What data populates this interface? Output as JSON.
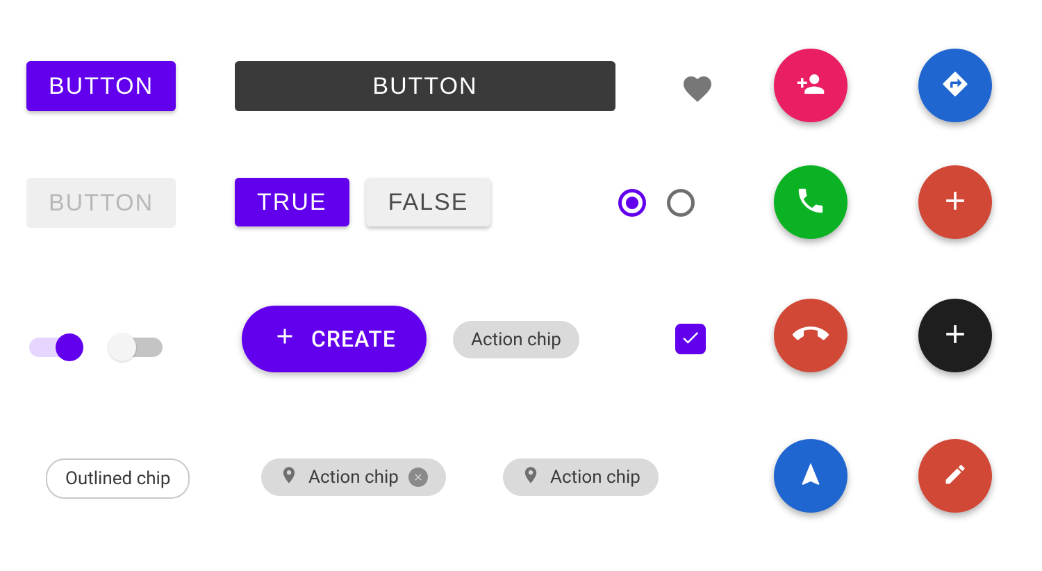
{
  "colors": {
    "purple": "#6200EE",
    "dark": "#3A3A3A",
    "pink": "#E91E63",
    "blue": "#1F66D0",
    "green": "#0BB224",
    "red": "#D14836",
    "black": "#1E1E1E",
    "gray": "#6F6F6F"
  },
  "row1": {
    "button_primary": "BUTTON",
    "button_dark": "BUTTON",
    "icon_button": "heart-icon",
    "fab_pink": "add-person-icon",
    "fab_blue": "directions-icon"
  },
  "row2": {
    "button_disabled": "BUTTON",
    "segment_true": "TRUE",
    "segment_false": "FALSE",
    "radio_selected": true,
    "radio_unselected": false,
    "fab_green": "phone-icon",
    "fab_red": "plus-icon"
  },
  "row3": {
    "switch_on": true,
    "switch_off": false,
    "create_button": "CREATE",
    "chip_action": "Action chip",
    "checkbox_checked": true,
    "fab_red": "hangup-icon",
    "fab_black": "plus-icon"
  },
  "row4": {
    "chip_outlined": "Outlined chip",
    "chip_action_close": "Action chip",
    "chip_action": "Action chip",
    "fab_blue": "navigation-icon",
    "fab_red": "edit-icon"
  }
}
